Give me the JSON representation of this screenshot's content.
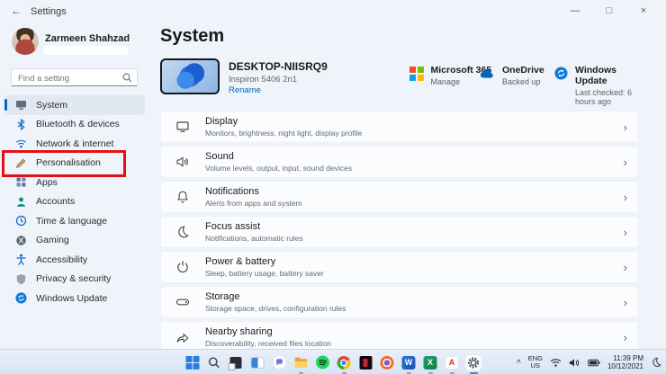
{
  "window": {
    "title": "Settings",
    "back_glyph": "←",
    "controls": {
      "minimize": "—",
      "maximize": "□",
      "close": "×"
    }
  },
  "sidebar": {
    "user": {
      "name": "Zarmeen Shahzad"
    },
    "search": {
      "placeholder": "Find a setting"
    },
    "items": [
      {
        "label": "System",
        "icon": "system-icon",
        "selected": true
      },
      {
        "label": "Bluetooth & devices",
        "icon": "bluetooth-icon"
      },
      {
        "label": "Network & internet",
        "icon": "network-icon"
      },
      {
        "label": "Personalisation",
        "icon": "personalisation-icon",
        "annotated": true
      },
      {
        "label": "Apps",
        "icon": "apps-icon"
      },
      {
        "label": "Accounts",
        "icon": "accounts-icon"
      },
      {
        "label": "Time & language",
        "icon": "time-language-icon"
      },
      {
        "label": "Gaming",
        "icon": "gaming-icon"
      },
      {
        "label": "Accessibility",
        "icon": "accessibility-icon"
      },
      {
        "label": "Privacy & security",
        "icon": "privacy-icon"
      },
      {
        "label": "Windows Update",
        "icon": "windows-update-icon"
      }
    ]
  },
  "main": {
    "title": "System",
    "device": {
      "name": "DESKTOP-NIISRQ9",
      "model": "Inspiron 5406 2n1",
      "rename_label": "Rename"
    },
    "status": [
      {
        "title": "Microsoft 365",
        "subtitle": "Manage",
        "icon": "microsoft-logo"
      },
      {
        "title": "OneDrive",
        "subtitle": "Backed up",
        "icon": "onedrive-icon"
      },
      {
        "title": "Windows Update",
        "subtitle": "Last checked: 6 hours ago",
        "icon": "windows-update-badge"
      }
    ],
    "chevron": "›",
    "rows": [
      {
        "title": "Display",
        "subtitle": "Monitors, brightness, night light, display profile",
        "icon": "display-icon"
      },
      {
        "title": "Sound",
        "subtitle": "Volume levels, output, input, sound devices",
        "icon": "sound-icon"
      },
      {
        "title": "Notifications",
        "subtitle": "Alerts from apps and system",
        "icon": "notifications-icon"
      },
      {
        "title": "Focus assist",
        "subtitle": "Notifications, automatic rules",
        "icon": "focus-assist-icon"
      },
      {
        "title": "Power & battery",
        "subtitle": "Sleep, battery usage, battery saver",
        "icon": "power-icon"
      },
      {
        "title": "Storage",
        "subtitle": "Storage space, drives, configuration rules",
        "icon": "storage-icon"
      },
      {
        "title": "Nearby sharing",
        "subtitle": "Discoverability, received files location",
        "icon": "nearby-sharing-icon"
      }
    ]
  },
  "taskbar": {
    "tray": {
      "chevron": "^",
      "language": "ENG",
      "region": "US",
      "time": "11:39 PM",
      "date": "10/12/2021"
    }
  },
  "annotation": {
    "color": "#e31212"
  },
  "colors": {
    "accent": "#0067c0"
  }
}
